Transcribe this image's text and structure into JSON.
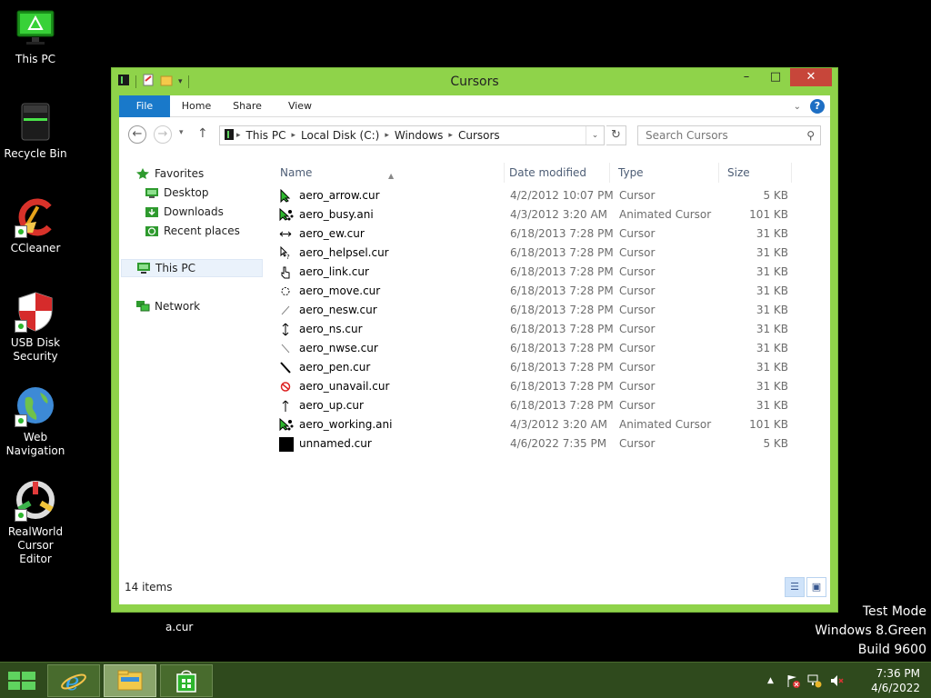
{
  "desktop": {
    "icons": [
      {
        "label": "This PC"
      },
      {
        "label": "Recycle Bin"
      },
      {
        "label": "CCleaner"
      },
      {
        "label": "USB Disk Security"
      },
      {
        "label": "Web Navigation"
      },
      {
        "label": "RealWorld Cursor Editor"
      }
    ],
    "stray_file": "a.cur",
    "watermark": [
      "Test Mode",
      "Windows 8.Green",
      "Build 9600"
    ]
  },
  "window": {
    "title": "Cursors",
    "ribbon": {
      "tabs": [
        "File",
        "Home",
        "Share",
        "View"
      ],
      "help": "?"
    },
    "address": {
      "crumbs": [
        "This PC",
        "Local Disk (C:)",
        "Windows",
        "Cursors"
      ],
      "search_placeholder": "Search Cursors"
    },
    "navpane": {
      "favorites": "Favorites",
      "fav_items": [
        "Desktop",
        "Downloads",
        "Recent places"
      ],
      "this_pc": "This PC",
      "network": "Network"
    },
    "columns": {
      "name": "Name",
      "date": "Date modified",
      "type": "Type",
      "size": "Size"
    },
    "files": [
      {
        "name": "aero_arrow.cur",
        "date": "4/2/2012 10:07 PM",
        "type": "Cursor",
        "size": "5 KB",
        "icon": "arrow-cursor-icon"
      },
      {
        "name": "aero_busy.ani",
        "date": "4/3/2012 3:20 AM",
        "type": "Animated Cursor",
        "size": "101 KB",
        "icon": "busy-cursor-icon"
      },
      {
        "name": "aero_ew.cur",
        "date": "6/18/2013 7:28 PM",
        "type": "Cursor",
        "size": "31 KB",
        "icon": "resize-ew-icon"
      },
      {
        "name": "aero_helpsel.cur",
        "date": "6/18/2013 7:28 PM",
        "type": "Cursor",
        "size": "31 KB",
        "icon": "help-cursor-icon"
      },
      {
        "name": "aero_link.cur",
        "date": "6/18/2013 7:28 PM",
        "type": "Cursor",
        "size": "31 KB",
        "icon": "hand-cursor-icon"
      },
      {
        "name": "aero_move.cur",
        "date": "6/18/2013 7:28 PM",
        "type": "Cursor",
        "size": "31 KB",
        "icon": "move-cursor-icon"
      },
      {
        "name": "aero_nesw.cur",
        "date": "6/18/2013 7:28 PM",
        "type": "Cursor",
        "size": "31 KB",
        "icon": "resize-nesw-icon"
      },
      {
        "name": "aero_ns.cur",
        "date": "6/18/2013 7:28 PM",
        "type": "Cursor",
        "size": "31 KB",
        "icon": "resize-ns-icon"
      },
      {
        "name": "aero_nwse.cur",
        "date": "6/18/2013 7:28 PM",
        "type": "Cursor",
        "size": "31 KB",
        "icon": "resize-nwse-icon"
      },
      {
        "name": "aero_pen.cur",
        "date": "6/18/2013 7:28 PM",
        "type": "Cursor",
        "size": "31 KB",
        "icon": "pen-cursor-icon"
      },
      {
        "name": "aero_unavail.cur",
        "date": "6/18/2013 7:28 PM",
        "type": "Cursor",
        "size": "31 KB",
        "icon": "unavailable-cursor-icon"
      },
      {
        "name": "aero_up.cur",
        "date": "6/18/2013 7:28 PM",
        "type": "Cursor",
        "size": "31 KB",
        "icon": "up-arrow-cursor-icon"
      },
      {
        "name": "aero_working.ani",
        "date": "4/3/2012 3:20 AM",
        "type": "Animated Cursor",
        "size": "101 KB",
        "icon": "working-cursor-icon"
      },
      {
        "name": "unnamed.cur",
        "date": "4/6/2022 7:35 PM",
        "type": "Cursor",
        "size": "5 KB",
        "icon": "blank-cursor-icon"
      }
    ],
    "status": "14 items"
  },
  "taskbar": {
    "time": "7:36 PM",
    "date": "4/6/2022"
  },
  "colors": {
    "window_frame": "#8fd34a",
    "file_tab": "#1979ca",
    "close_button": "#c7463a",
    "taskbar": "#2f4a1d"
  }
}
